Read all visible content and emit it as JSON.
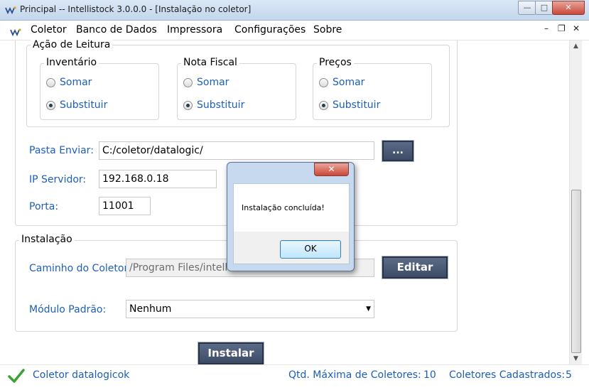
{
  "window": {
    "title": "Principal -- Intellistock 3.0.0.0 - [Instalação no coletor]",
    "controls": {
      "minimize": "—",
      "maximize": "□",
      "close": "✕"
    }
  },
  "menu": {
    "items": [
      "Coletor",
      "Banco de Dados",
      "Impressora",
      "Configurações",
      "Sobre"
    ],
    "mdi_controls": [
      "–",
      "❐",
      "✕"
    ]
  },
  "leitura": {
    "title": "Ação de Leitura",
    "groups": [
      {
        "title": "Inventário",
        "options": [
          "Somar",
          "Substituir"
        ],
        "selected": "Substituir"
      },
      {
        "title": "Nota Fiscal",
        "options": [
          "Somar",
          "Substituir"
        ],
        "selected": "Substituir"
      },
      {
        "title": "Preços",
        "options": [
          "Somar",
          "Substituir"
        ],
        "selected": "Substituir"
      }
    ]
  },
  "config": {
    "pasta_label": "Pasta Enviar:",
    "pasta_value": "C:/coletor/datalogic/",
    "browse_label": "...",
    "ip_label": "IP Servidor:",
    "ip_value": "192.168.0.18",
    "porta_label": "Porta:",
    "porta_value": "11001"
  },
  "instalacao": {
    "title": "Instalação",
    "caminho_label": "Caminho do Coletor:",
    "caminho_value": "/Program Files/intellistock",
    "editar_label": "Editar",
    "modulo_label": "Módulo Padrão:",
    "modulo_value": "Nenhum",
    "instalar_label": "Instalar"
  },
  "status": {
    "coletor": "Coletor datalogicok",
    "qtd_label": "Qtd. Máxima de Coletores:",
    "qtd_value": "10",
    "cadastrados_label": "Coletores Cadastrados:",
    "cadastrados_value": "5"
  },
  "dialog": {
    "message": "Instalação concluída!",
    "ok_label": "OK",
    "close": "✕"
  },
  "colors": {
    "accent_blue": "#1d5fb4",
    "button_dark": "#3d4b66",
    "dialog_frame": "#c7d9ee"
  }
}
